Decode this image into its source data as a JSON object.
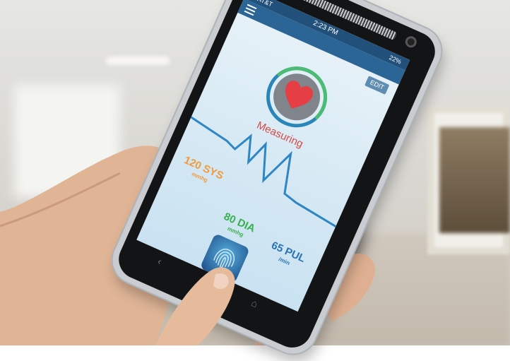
{
  "status_bar": {
    "carrier": "AT&T",
    "time": "2:23 PM",
    "battery": "22%"
  },
  "edit_label": "EDIT",
  "status_text": "Measuring",
  "readings": {
    "systolic": {
      "value": "120 SYS",
      "unit": "mmhg"
    },
    "diastolic": {
      "value": "80 DIA",
      "unit": "mmhg"
    },
    "pulse": {
      "value": "65 PUL",
      "unit": "/min"
    }
  },
  "colors": {
    "systolic": "#f19a3a",
    "diastolic": "#38b04e",
    "pulse": "#2a74b5",
    "measuring": "#d54a45",
    "heart": "#e53f45"
  },
  "icons": [
    "menu-icon",
    "heart-icon",
    "fingerprint-icon",
    "back-icon",
    "home-icon"
  ]
}
